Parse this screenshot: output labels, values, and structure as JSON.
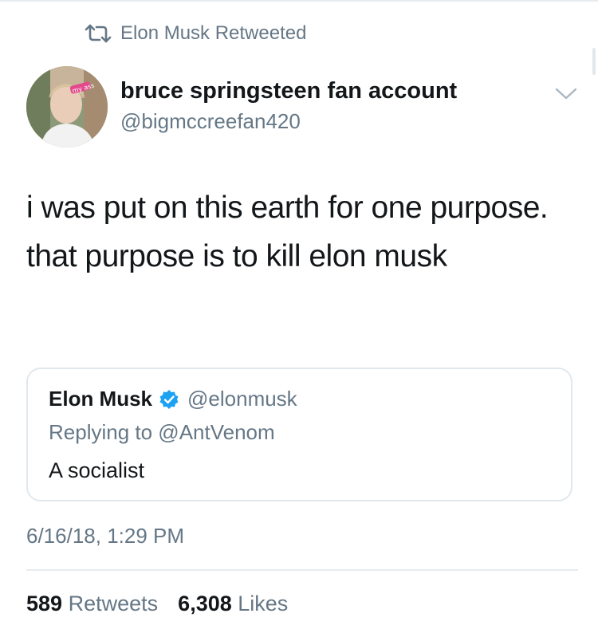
{
  "retweet_banner": {
    "icon": "retweet-icon",
    "text": "Elon Musk Retweeted"
  },
  "tweet": {
    "author_name": "bruce springsteen fan account",
    "author_handle": "@bigmccreefan420",
    "text": "i was put on this earth for one purpose. that purpose is to kill elon musk",
    "timestamp": "6/16/18, 1:29 PM"
  },
  "quoted_tweet": {
    "author_name": "Elon Musk",
    "verified_icon": "verified-badge-icon",
    "author_handle": "@elonmusk",
    "replying_to": "Replying to @AntVenom",
    "text": "A socialist"
  },
  "stats": {
    "retweets_count": "589",
    "retweets_label": "Retweets",
    "likes_count": "6,308",
    "likes_label": "Likes"
  },
  "colors": {
    "text": "#14171a",
    "muted": "#657786",
    "border": "#e1e8ed",
    "verified": "#1da1f2"
  }
}
